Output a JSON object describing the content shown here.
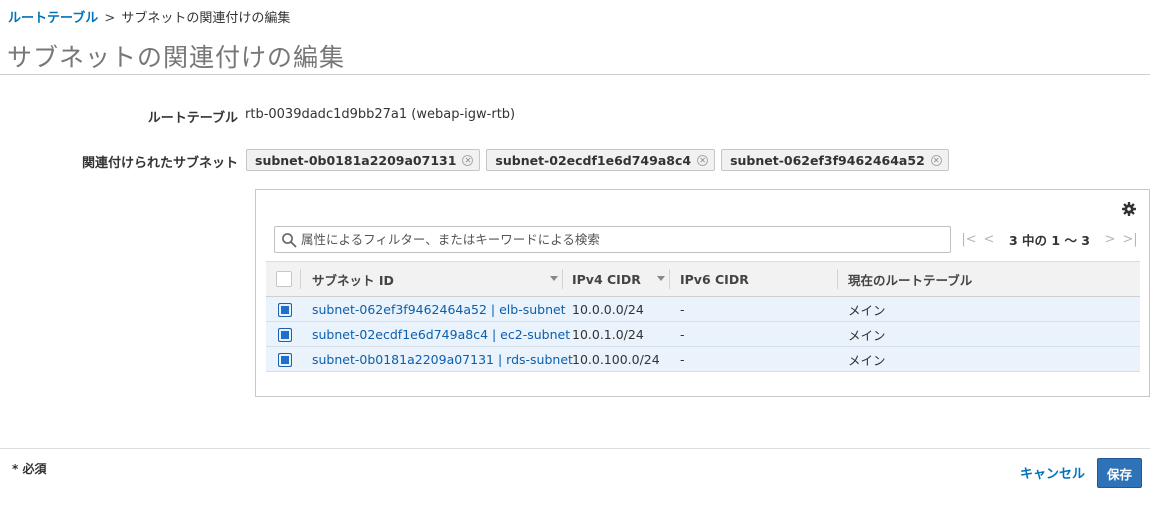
{
  "breadcrumb": {
    "parent": "ルートテーブル",
    "separator": ">",
    "current": "サブネットの関連付けの編集"
  },
  "page": {
    "title": "サブネットの関連付けの編集"
  },
  "route_table": {
    "label": "ルートテーブル",
    "value": "rtb-0039dadc1d9bb27a1 (webap-igw-rtb)"
  },
  "associated_subnets": {
    "label": "関連付けられたサブネット",
    "tokens": [
      "subnet-0b0181a2209a07131",
      "subnet-02ecdf1e6d749a8c4",
      "subnet-062ef3f9462464a52"
    ]
  },
  "icons": {
    "settings": "gear-icon",
    "search": "search-icon",
    "remove_token": "close-circle-icon"
  },
  "search": {
    "placeholder": "属性によるフィルター、またはキーワードによる検索",
    "value": ""
  },
  "pager": {
    "text": "3 中の 1 ～ 3",
    "first": "|<",
    "prev": "<",
    "next": ">",
    "last": ">|"
  },
  "table": {
    "headers": {
      "subnet_id": "サブネット ID",
      "ipv4": "IPv4 CIDR",
      "ipv6": "IPv6 CIDR",
      "current_route_table": "現在のルートテーブル"
    },
    "rows": [
      {
        "subnet": "subnet-062ef3f9462464a52 | elb-subnet",
        "ipv4": "10.0.0.0/24",
        "ipv6": "-",
        "route_table": "メイン",
        "selected": true
      },
      {
        "subnet": "subnet-02ecdf1e6d749a8c4 | ec2-subnet",
        "ipv4": "10.0.1.0/24",
        "ipv6": "-",
        "route_table": "メイン",
        "selected": true
      },
      {
        "subnet": "subnet-0b0181a2209a07131 | rds-subnet",
        "ipv4": "10.0.100.0/24",
        "ipv6": "-",
        "route_table": "メイン",
        "selected": true
      }
    ]
  },
  "footer": {
    "required_note": "* 必須",
    "cancel_label": "キャンセル",
    "save_label": "保存"
  },
  "colors": {
    "link": "#0073bb",
    "primary_button": "#2e73b8",
    "selected_row": "#eaf2fb",
    "checkbox_checked": "#1f6fcf"
  }
}
